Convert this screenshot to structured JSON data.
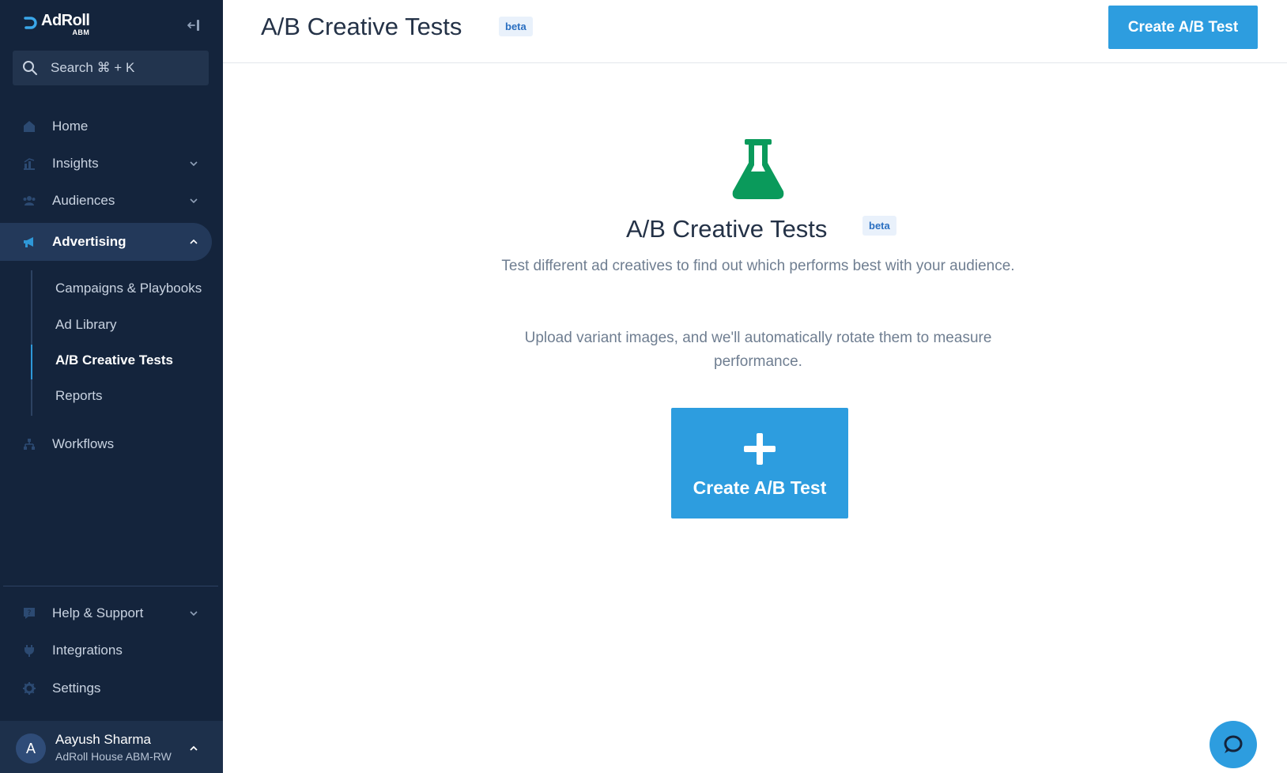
{
  "colors": {
    "sidebar_bg": "#14243c",
    "accent": "#2d9ddf",
    "flask": "#0a9a5b",
    "beta_text": "#2a6fc1",
    "beta_bg": "#e9f1fb"
  },
  "brand": {
    "name": "AdRoll",
    "sub": "ABM"
  },
  "sidebar": {
    "search_placeholder": "Search ⌘ + K",
    "nav": [
      {
        "label": "Home",
        "icon": "home-icon"
      },
      {
        "label": "Insights",
        "icon": "chart-icon"
      },
      {
        "label": "Audiences",
        "icon": "people-icon"
      },
      {
        "label": "Advertising",
        "icon": "megaphone-icon"
      },
      {
        "label": "Workflows",
        "icon": "workflow-icon"
      }
    ],
    "advertising_sub": [
      {
        "label": "Campaigns & Playbooks"
      },
      {
        "label": "Ad Library"
      },
      {
        "label": "A/B Creative Tests"
      },
      {
        "label": "Reports"
      }
    ],
    "bottom_nav": [
      {
        "label": "Help & Support",
        "icon": "help-icon"
      },
      {
        "label": "Integrations",
        "icon": "plug-icon"
      },
      {
        "label": "Settings",
        "icon": "gear-icon"
      }
    ],
    "user": {
      "initial": "A",
      "name": "Aayush Sharma",
      "org": "AdRoll House ABM-RW"
    }
  },
  "header": {
    "title": "A/B Creative Tests",
    "badge": "beta",
    "create_button": "Create A/B Test"
  },
  "empty_state": {
    "title": "A/B Creative Tests",
    "badge": "beta",
    "desc1": "Test different ad creatives to find out which performs best with your audience.",
    "desc2": "Upload variant images, and we'll automatically rotate them to measure performance.",
    "button_label": "Create A/B Test"
  }
}
